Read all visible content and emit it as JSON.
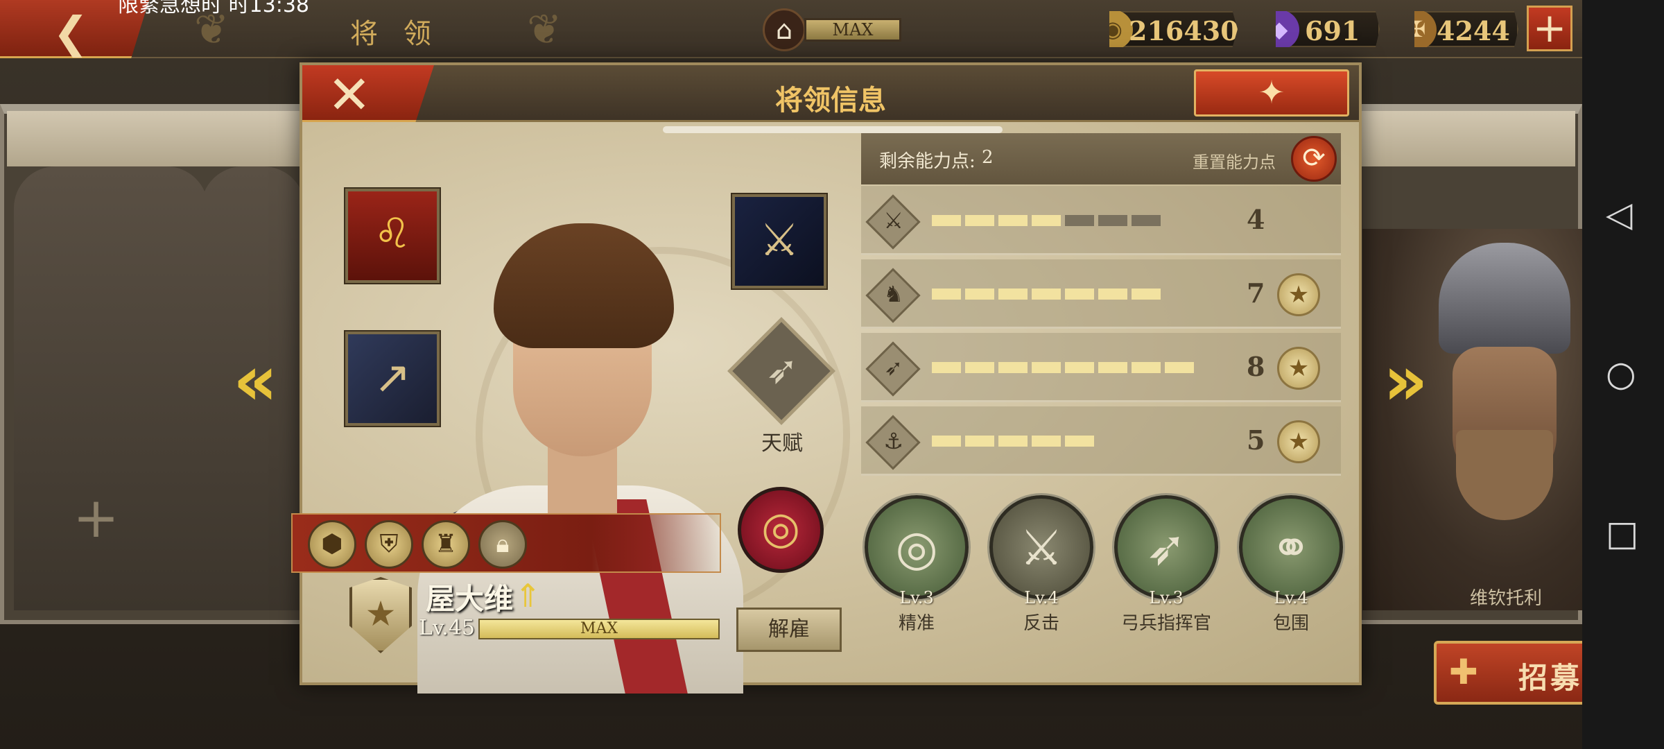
{
  "status_bar": {
    "time_partial": "限緊急想时 时13:38"
  },
  "top_bar": {
    "title": "将 领",
    "rank_label": "MAX",
    "resources": [
      {
        "name": "coin",
        "value": "216430",
        "icon": "coin-icon",
        "color": "#c8a04a"
      },
      {
        "name": "gem",
        "value": "691",
        "icon": "gem-icon",
        "color": "#7a4ab8"
      },
      {
        "name": "spqr",
        "value": "4244",
        "icon": "spqr-eagle-icon",
        "color": "#b8843a"
      }
    ]
  },
  "background": {
    "right_hero_name": "维钦托利",
    "recruit_label": "招募"
  },
  "dialog": {
    "title": "将领信息",
    "remaining_points_label": "剩余能力点:",
    "remaining_points_value": "2",
    "reset_points_label": "重置能力点",
    "stats": [
      {
        "icon": "sword-icon",
        "value": "4",
        "filled": 4,
        "total": 7,
        "has_star": false
      },
      {
        "icon": "horse-icon",
        "value": "7",
        "filled": 7,
        "total": 7,
        "has_star": true
      },
      {
        "icon": "bow-icon",
        "value": "8",
        "filled": 8,
        "total": 8,
        "has_star": true
      },
      {
        "icon": "anchor-icon",
        "value": "5",
        "filled": 5,
        "total": 5,
        "has_star": true
      }
    ],
    "talent_label": "天赋",
    "hero": {
      "name": "屋大维",
      "level": "Lv.45",
      "xp_label": "MAX"
    },
    "dismiss_label": "解雇",
    "skills": [
      {
        "icon": "target-icon",
        "level": "Lv.3",
        "name": "精准"
      },
      {
        "icon": "duel-icon",
        "level": "Lv.4",
        "name": "反击"
      },
      {
        "icon": "bow-commander-icon",
        "level": "Lv.3",
        "name": "弓兵指挥官"
      },
      {
        "icon": "encircle-icon",
        "level": "Lv.4",
        "name": "包围"
      }
    ]
  }
}
